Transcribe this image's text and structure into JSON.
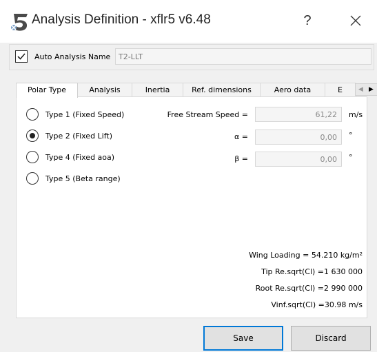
{
  "window": {
    "title": "Analysis Definition - xflr5 v6.48",
    "help_label": "?"
  },
  "auto_analysis": {
    "checked": true,
    "label": "Auto Analysis Name",
    "name_value": "T2-LLT"
  },
  "tabs": [
    {
      "label": "Polar Type",
      "active": true
    },
    {
      "label": "Analysis",
      "active": false
    },
    {
      "label": "Inertia",
      "active": false
    },
    {
      "label": "Ref. dimensions",
      "active": false
    },
    {
      "label": "Aero data",
      "active": false
    },
    {
      "label": "E",
      "active": false
    }
  ],
  "polar_types": [
    {
      "label": "Type 1 (Fixed Speed)",
      "selected": false
    },
    {
      "label": "Type 2 (Fixed Lift)",
      "selected": true
    },
    {
      "label": "Type 4 (Fixed aoa)",
      "selected": false
    },
    {
      "label": "Type 5 (Beta range)",
      "selected": false
    }
  ],
  "fields": [
    {
      "label": "Free Stream Speed =",
      "value": "61,22",
      "unit": "m/s"
    },
    {
      "label": "α =",
      "value": "0,00",
      "unit": "°"
    },
    {
      "label": "β =",
      "value": "0,00",
      "unit": "°"
    }
  ],
  "info": {
    "wing_loading": "Wing Loading =  54.210 kg/m²",
    "tip_re": "Tip Re.sqrt(Cl) =1 630 000",
    "root_re": "Root Re.sqrt(Cl) =2 990 000",
    "vinf": "Vinf.sqrt(Cl) =30.98 m/s"
  },
  "buttons": {
    "save": "Save",
    "discard": "Discard"
  }
}
